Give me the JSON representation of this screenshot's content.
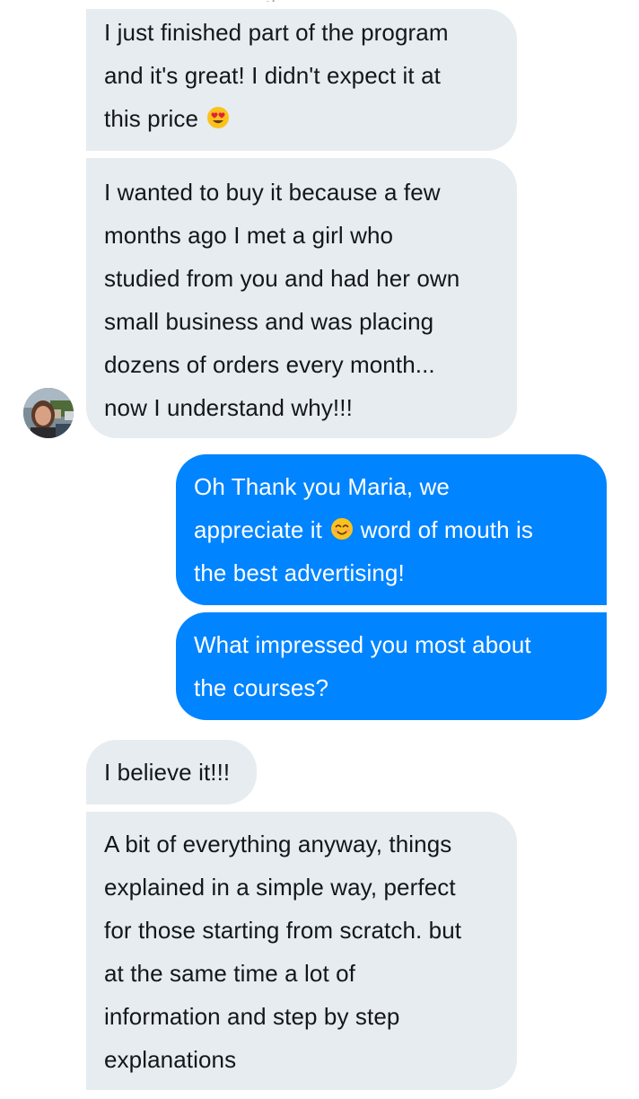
{
  "conversation": {
    "sender_name_cut": "g",
    "avatar": {
      "name": "Maria"
    },
    "messages": [
      {
        "side": "incoming",
        "lines": [
          "I just finished part of the program",
          "and it's great! I didn't expect it at",
          "this price"
        ],
        "trailing_emoji": "heart-eyes-emoji"
      },
      {
        "side": "incoming",
        "lines": [
          "I wanted to buy it because a few",
          "months ago I met a girl who",
          "studied from you and had her own",
          "small business and was placing",
          "dozens of orders every month...",
          "now I understand why!!!"
        ]
      },
      {
        "side": "outgoing",
        "lines": [
          "Oh Thank you Maria, we",
          "appreciate it",
          "word of mouth is",
          "the best advertising!"
        ],
        "inline_emoji": "smiling-face-emoji"
      },
      {
        "side": "outgoing",
        "lines": [
          "What impressed you most about",
          "the courses?"
        ]
      },
      {
        "side": "incoming",
        "lines": [
          "I believe it!!!"
        ]
      },
      {
        "side": "incoming",
        "lines": [
          "A bit of everything anyway, things",
          "explained in a simple way, perfect",
          "for those starting from scratch. but",
          "at the same time a lot of",
          "information and step by step",
          "explanations"
        ]
      }
    ]
  },
  "colors": {
    "incoming_bubble": "#e6ecf0",
    "incoming_text": "#14171a",
    "outgoing_bubble": "#0084ff",
    "outgoing_text": "#ffffff"
  }
}
